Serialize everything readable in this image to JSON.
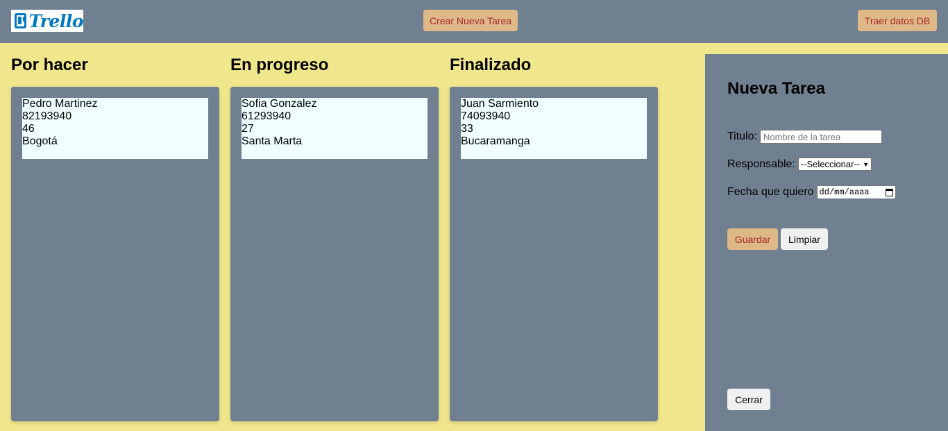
{
  "header": {
    "logo_text": "Trello",
    "create_button": "Crear Nueva Tarea",
    "fetch_button": "Traer datos DB"
  },
  "columns": [
    {
      "title": "Por hacer",
      "cards": [
        {
          "name": "Pedro Martinez",
          "id": "82193940",
          "age": "46",
          "city": "Bogotá"
        }
      ]
    },
    {
      "title": "En progreso",
      "cards": [
        {
          "name": "Sofia Gonzalez",
          "id": "61293940",
          "age": "27",
          "city": "Santa Marta"
        }
      ]
    },
    {
      "title": "Finalizado",
      "cards": [
        {
          "name": "Juan Sarmiento",
          "id": "74093940",
          "age": "33",
          "city": "Bucaramanga"
        }
      ]
    }
  ],
  "form": {
    "title": "Nueva Tarea",
    "titulo_label": "Titulo:",
    "titulo_placeholder": "Nombre de la tarea",
    "responsable_label": "Responsable:",
    "responsable_selected": "--Seleccionar--",
    "fecha_label": "Fecha que quiero",
    "fecha_placeholder": "dd/mm/aaaa",
    "save_button": "Guardar",
    "clear_button": "Limpiar",
    "close_button": "Cerrar"
  },
  "colors": {
    "header_bg": "#708090",
    "page_bg": "#f0e68c",
    "card_bg": "#f0ffff",
    "accent_button": "#deb887",
    "accent_text": "#a52a2a",
    "logo_blue": "#0079bf"
  }
}
